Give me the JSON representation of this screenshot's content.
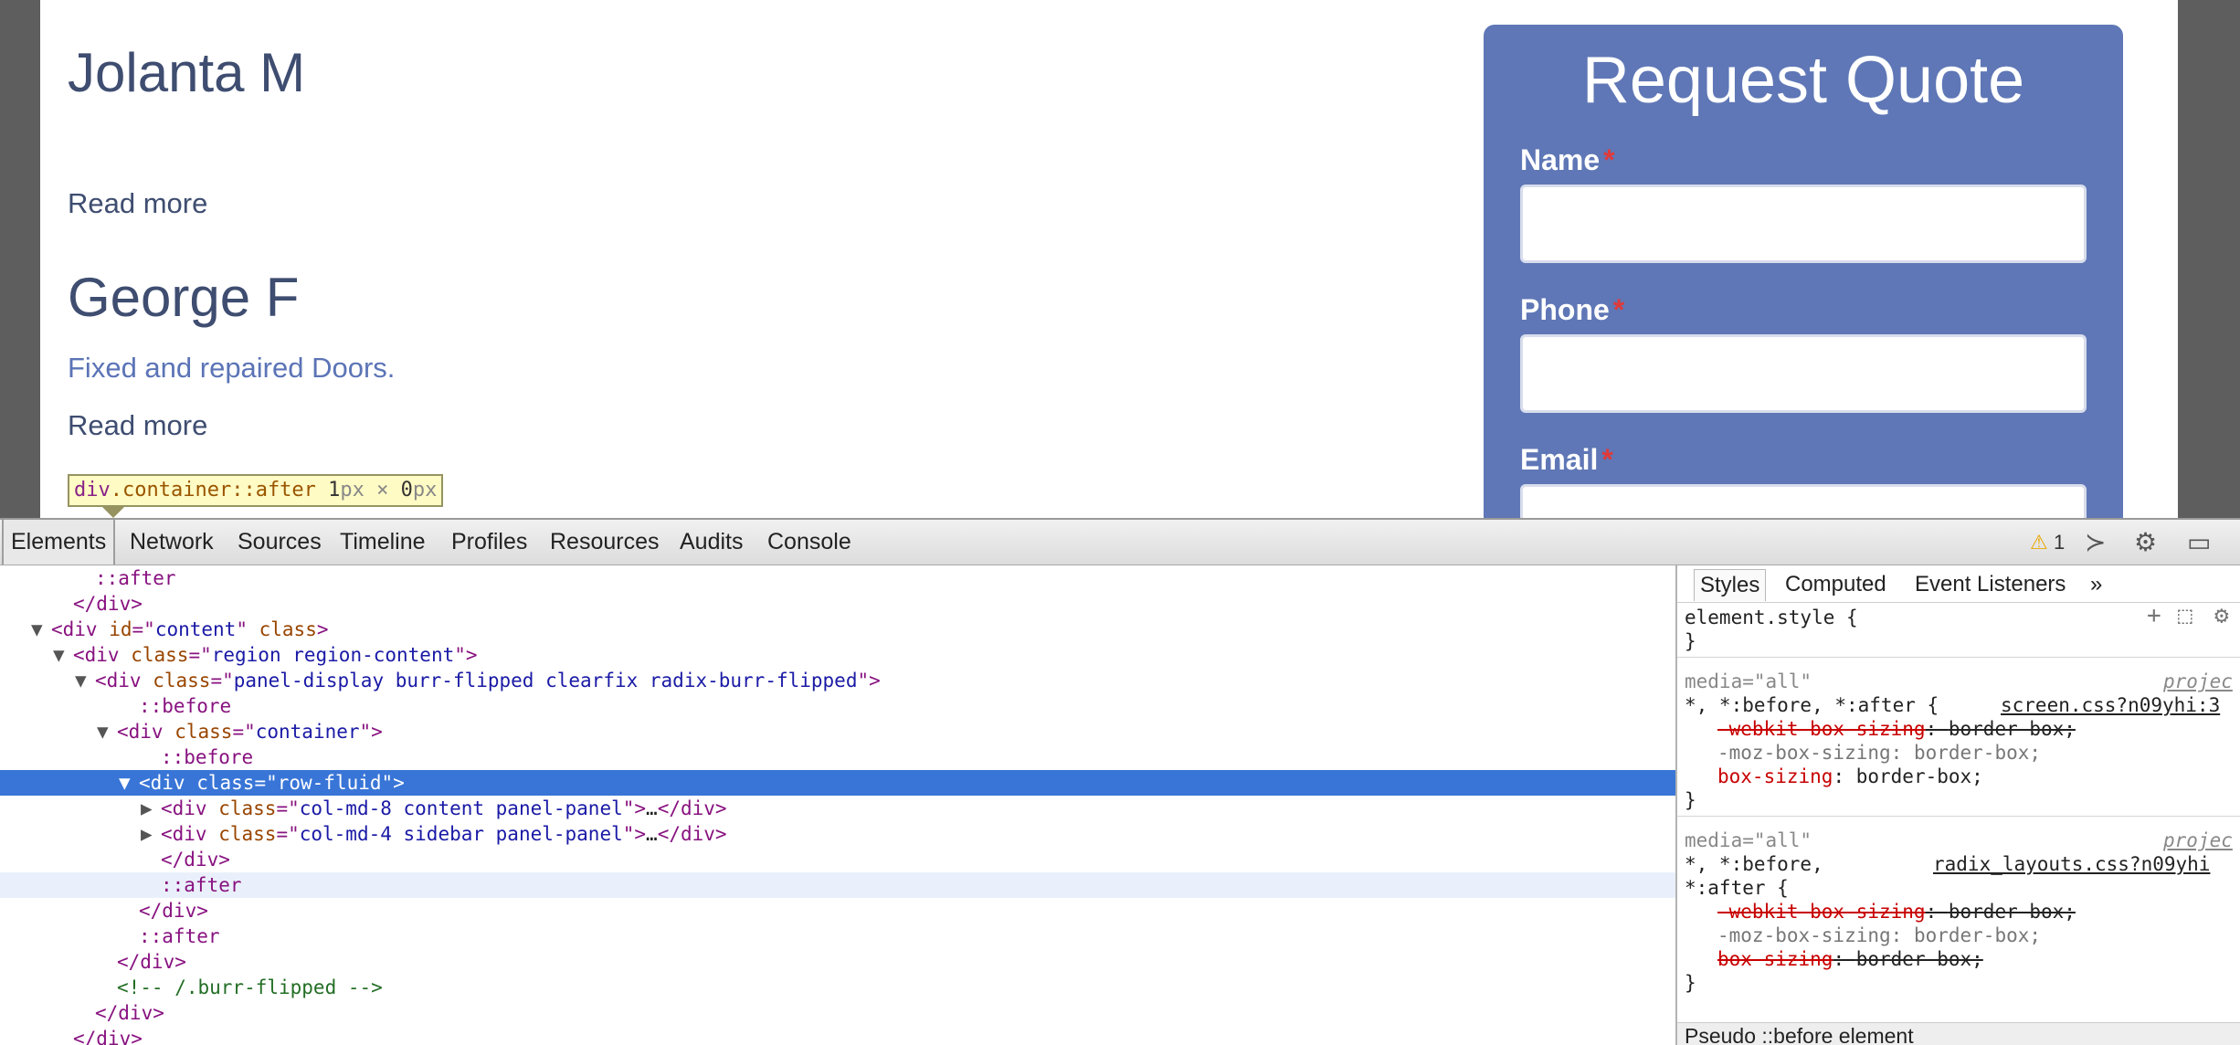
{
  "page": {
    "people": [
      {
        "name": "Jolanta M",
        "description": "",
        "read_more": "Read more"
      },
      {
        "name": "George F",
        "description": "Fixed and repaired Doors.",
        "read_more": "Read more"
      }
    ],
    "inspect_tooltip": {
      "tag": "div",
      "class": ".container",
      "pseudo": "::after",
      "width": "1",
      "height": "0",
      "unit": "px",
      "times": "×"
    },
    "quote_form": {
      "title": "Request Quote",
      "required_mark": "*",
      "fields": [
        {
          "label": "Name",
          "value": ""
        },
        {
          "label": "Phone",
          "value": ""
        },
        {
          "label": "Email",
          "value": ""
        }
      ]
    }
  },
  "devtools": {
    "tabs": [
      "Elements",
      "Network",
      "Sources",
      "Timeline",
      "Profiles",
      "Resources",
      "Audits",
      "Console"
    ],
    "active_tab": "Elements",
    "warning_count": "1",
    "dom_lines": [
      {
        "indent": 4,
        "tri": "",
        "parts": [
          [
            "t-pseudo",
            "::after"
          ]
        ]
      },
      {
        "indent": 3,
        "tri": "",
        "parts": [
          [
            "t-tag",
            "</div>"
          ]
        ]
      },
      {
        "indent": 2,
        "tri": "▼",
        "parts": [
          [
            "t-tag",
            "<div "
          ],
          [
            "t-attr",
            "id"
          ],
          [
            "t-tag",
            "=\""
          ],
          [
            "t-val",
            "content"
          ],
          [
            "t-tag",
            "\" "
          ],
          [
            "t-attr",
            "class"
          ],
          [
            "t-tag",
            ">"
          ]
        ]
      },
      {
        "indent": 3,
        "tri": "▼",
        "parts": [
          [
            "t-tag",
            "<div "
          ],
          [
            "t-attr",
            "class"
          ],
          [
            "t-tag",
            "=\""
          ],
          [
            "t-val",
            "region region-content"
          ],
          [
            "t-tag",
            "\">"
          ]
        ]
      },
      {
        "indent": 4,
        "tri": "▼",
        "parts": [
          [
            "t-tag",
            "<div "
          ],
          [
            "t-attr",
            "class"
          ],
          [
            "t-tag",
            "=\""
          ],
          [
            "t-val",
            "panel-display burr-flipped clearfix radix-burr-flipped"
          ],
          [
            "t-tag",
            "\">"
          ]
        ]
      },
      {
        "indent": 6,
        "tri": "",
        "parts": [
          [
            "t-pseudo",
            "::before"
          ]
        ]
      },
      {
        "indent": 5,
        "tri": "▼",
        "parts": [
          [
            "t-tag",
            "<div "
          ],
          [
            "t-attr",
            "class"
          ],
          [
            "t-tag",
            "=\""
          ],
          [
            "t-val",
            "container"
          ],
          [
            "t-tag",
            "\">"
          ]
        ]
      },
      {
        "indent": 7,
        "tri": "",
        "parts": [
          [
            "t-pseudo",
            "::before"
          ]
        ]
      },
      {
        "indent": 6,
        "tri": "▼",
        "selected": true,
        "parts": [
          [
            "t-tag",
            "<div "
          ],
          [
            "t-attr",
            "class"
          ],
          [
            "t-tag",
            "=\""
          ],
          [
            "t-val",
            "row-fluid"
          ],
          [
            "t-tag",
            "\">"
          ]
        ]
      },
      {
        "indent": 7,
        "tri": "▶",
        "parts": [
          [
            "t-tag",
            "<div "
          ],
          [
            "t-attr",
            "class"
          ],
          [
            "t-tag",
            "=\""
          ],
          [
            "t-val",
            "col-md-8 content panel-panel"
          ],
          [
            "t-tag",
            "\">"
          ],
          [
            "t-text",
            "…"
          ],
          [
            "t-tag",
            "</div>"
          ]
        ]
      },
      {
        "indent": 7,
        "tri": "▶",
        "parts": [
          [
            "t-tag",
            "<div "
          ],
          [
            "t-attr",
            "class"
          ],
          [
            "t-tag",
            "=\""
          ],
          [
            "t-val",
            "col-md-4 sidebar panel-panel"
          ],
          [
            "t-tag",
            "\">"
          ],
          [
            "t-text",
            "…"
          ],
          [
            "t-tag",
            "</div>"
          ]
        ]
      },
      {
        "indent": 7,
        "tri": "",
        "parts": [
          [
            "t-tag",
            "</div>"
          ]
        ]
      },
      {
        "indent": 7,
        "tri": "",
        "hover": true,
        "parts": [
          [
            "t-pseudo",
            "::after"
          ]
        ]
      },
      {
        "indent": 6,
        "tri": "",
        "parts": [
          [
            "t-tag",
            "</div>"
          ]
        ]
      },
      {
        "indent": 6,
        "tri": "",
        "parts": [
          [
            "t-pseudo",
            "::after"
          ]
        ]
      },
      {
        "indent": 5,
        "tri": "",
        "parts": [
          [
            "t-tag",
            "</div>"
          ]
        ]
      },
      {
        "indent": 5,
        "tri": "",
        "parts": [
          [
            "t-comment",
            "<!-- /.burr-flipped -->"
          ]
        ]
      },
      {
        "indent": 4,
        "tri": "",
        "parts": [
          [
            "t-tag",
            "</div>"
          ]
        ]
      },
      {
        "indent": 3,
        "tri": "",
        "parts": [
          [
            "t-tag",
            "</div>"
          ]
        ]
      }
    ],
    "styles": {
      "tabs": [
        "Styles",
        "Computed",
        "Event Listeners",
        "»"
      ],
      "active_tab": "Styles",
      "element_style": {
        "open": "element.style {",
        "close": "}"
      },
      "rule1": {
        "media": "media=\"all\"",
        "media_link": "projec",
        "selector": "*, *:before, *:after {",
        "source": "screen.css?n09yhi:3",
        "props": [
          {
            "name": "-webkit-box-sizing",
            "value": "border-box;",
            "struck": true,
            "invalid": true
          },
          {
            "name": "-moz-box-sizing",
            "value": "border-box;",
            "struck": false,
            "invalid": true
          },
          {
            "name": "box-sizing",
            "value": "border-box;",
            "struck": false,
            "invalid": false
          }
        ],
        "close": "}"
      },
      "rule2": {
        "media": "media=\"all\"",
        "media_link": "projec",
        "selector_line1": "*, *:before,",
        "selector_line2": "*:after {",
        "source": "radix_layouts.css?n09yhi",
        "props": [
          {
            "name": "-webkit-box-sizing",
            "value": "border-box;",
            "struck": true,
            "invalid": true
          },
          {
            "name": "-moz-box-sizing",
            "value": "border-box;",
            "struck": false,
            "invalid": true
          },
          {
            "name": "box-sizing",
            "value": "border-box;",
            "struck": true,
            "invalid": false
          }
        ],
        "close": "}"
      },
      "pseudo_header": "Pseudo ::before element"
    }
  }
}
